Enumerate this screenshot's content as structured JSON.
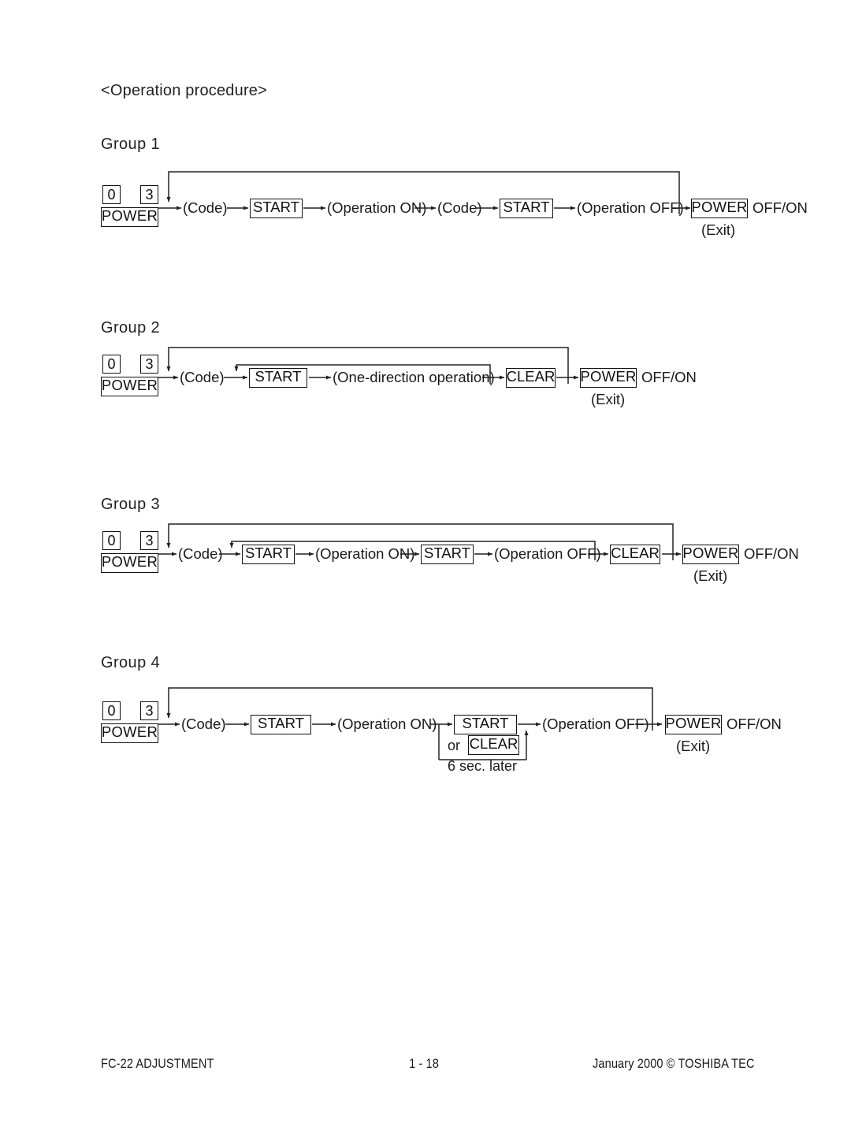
{
  "page": {
    "heading": "<Operation procedure>"
  },
  "labels": {
    "code": "(Code)",
    "start": "START",
    "clear": "CLEAR",
    "power": "POWER",
    "digit_0": "0",
    "digit_3": "3",
    "power_off_on": "OFF/ON",
    "exit": "(Exit)",
    "operation_on": "(Operation ON)",
    "operation_off": "(Operation OFF)",
    "one_direction": "(One-direction operation)",
    "or": "or",
    "six_sec_later": "6 sec. later"
  },
  "groups": [
    {
      "title": "Group 1",
      "keys": {
        "digit_0": "0",
        "digit_3": "3",
        "power": "POWER"
      },
      "steps": [
        "(Code)",
        "START",
        "(Operation ON)",
        "(Code)",
        "START",
        "(Operation OFF)",
        "POWER"
      ],
      "terminal": {
        "key": "POWER",
        "suffix": "OFF/ON",
        "note": "(Exit)"
      },
      "loops": [
        {
          "from": "after-operation-off",
          "to": "code"
        }
      ]
    },
    {
      "title": "Group 2",
      "keys": {
        "digit_0": "0",
        "digit_3": "3",
        "power": "POWER"
      },
      "steps": [
        "(Code)",
        "START",
        "(One-direction operation)",
        "CLEAR",
        "POWER"
      ],
      "terminal": {
        "key": "POWER",
        "suffix": "OFF/ON",
        "note": "(Exit)"
      },
      "loops": [
        {
          "from": "before-clear",
          "to": "start"
        },
        {
          "from": "after-clear",
          "to": "code"
        }
      ]
    },
    {
      "title": "Group 3",
      "keys": {
        "digit_0": "0",
        "digit_3": "3",
        "power": "POWER"
      },
      "steps": [
        "(Code)",
        "START",
        "(Operation ON)",
        "START",
        "(Operation OFF)",
        "CLEAR",
        "POWER"
      ],
      "terminal": {
        "key": "POWER",
        "suffix": "OFF/ON",
        "note": "(Exit)"
      },
      "loops": [
        {
          "from": "before-clear",
          "to": "start"
        },
        {
          "from": "after-clear",
          "to": "code"
        }
      ]
    },
    {
      "title": "Group 4",
      "keys": {
        "digit_0": "0",
        "digit_3": "3",
        "power": "POWER"
      },
      "steps": [
        "(Code)",
        "START",
        "(Operation ON)",
        "START",
        "or",
        "CLEAR",
        "6 sec. later",
        "(Operation OFF)",
        "POWER"
      ],
      "terminal": {
        "key": "POWER",
        "suffix": "OFF/ON",
        "note": "(Exit)"
      },
      "loops": [
        {
          "from": "after-operation-off",
          "to": "code"
        },
        {
          "from": "timeout-6-sec",
          "to": "after-start"
        }
      ]
    }
  ],
  "footer": {
    "left": "FC-22 ADJUSTMENT",
    "center": "1 - 18",
    "right": "January 2000  ©  TOSHIBA TEC"
  }
}
